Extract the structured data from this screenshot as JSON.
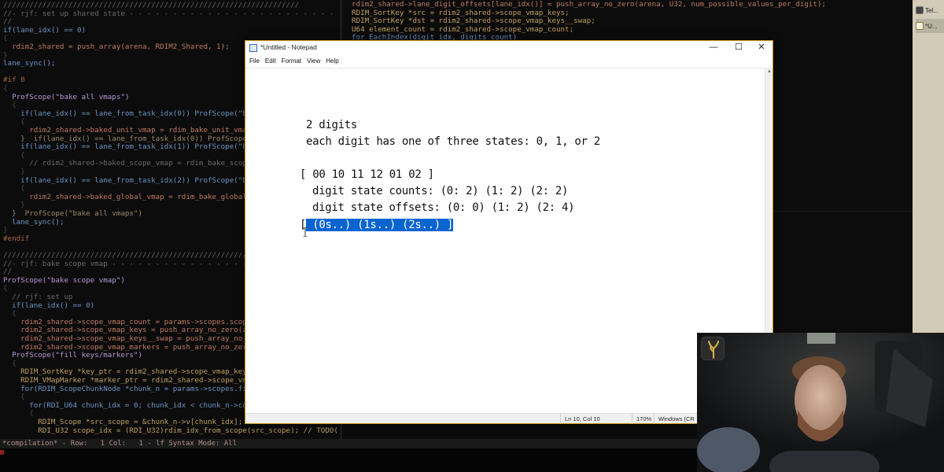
{
  "editor": {
    "left_pane_lines": [
      "////////////////////////////////////////////////////////////////////",
      "//- rjf: set up shared state - - - - - - - - - - - - - - - - - - - - - - - - - - -",
      "//",
      "if(lane_idx() == 0)",
      "{",
      "  rdim2_shared = push_array(arena, RDIM2_Shared, 1);",
      "}",
      "lane_sync();",
      "",
      "#if 0",
      "{",
      "  ProfScope(\"bake all vmaps\")",
      "  {",
      "    if(lane_idx() == lane_from_task_idx(0)) ProfScope(\"bake unit",
      "    {",
      "      rdim2_shared->baked_unit_vmap = rdim_bake_unit_vmap(arena,",
      "    }  if(lane_idx() == lane_from_task_idx(0)) ProfScope(\"bake unit vmap",
      "    if(lane_idx() == lane_from_task_idx(1)) ProfScope(\"bake sco",
      "    {",
      "      // rdim2_shared->baked_scope_vmap = rdim_bake_scope_vmap(a",
      "    }",
      "    if(lane_idx() == lane_from_task_idx(2)) ProfScope(\"bake glo",
      "    {",
      "      rdim2_shared->baked_global_vmap = rdim_bake_global_vmap(ar",
      "    }",
      "  }  ProfScope(\"bake all vmaps\")",
      "  lane_sync();",
      "}",
      "#endif",
      "",
      "////////////////////////////////////////////////////////////////////",
      "//- rjf: bake scope vmap - - - - - - - - - - - - - - - - - - - - - - - - - - - -",
      "//",
      "ProfScope(\"bake scope vmap\")",
      "{",
      "  // rjf: set up",
      "  if(lane_idx() == 0)",
      "  {",
      "    rdim2_shared->scope_vmap_count = params->scopes.scope_voff_",
      "    rdim2_shared->scope_vmap_keys = push_array_no_zero(arena, R",
      "    rdim2_shared->scope_vmap_keys__swap = push_array_no_zero(ar",
      "    rdim2_shared->scope_vmap_markers = push_array_no_zero(arena",
      "  ProfScope(\"fill keys/markers\")",
      "  {",
      "    RDIM_SortKey *key_ptr = rdim2_shared->scope_vmap_keys;",
      "    RDIM_VMapMarker *marker_ptr = rdim2_shared->scope_vmap_mar",
      "    for(RDIM_ScopeChunkNode *chunk_n = params->scopes.first; c",
      "    {",
      "      for(RDI_U64 chunk_idx = 0; chunk_idx < chunk_n->count; ch",
      "      {",
      "        RDIM_Scope *src_scope = &chunk_n->v[chunk_idx];",
      "        RDI_U32 scope_idx = (RDI_U32)rdim_idx_from_scope(src_scope); // TODO(rjf): @u64_"
    ],
    "right_pane_lines": [
      "rdim2_shared->lane_digit_offsets[lane_idx()] = push_array_no_zero(arena, U32, num_possible_values_per_digit);",
      "RDIM_SortKey *src = rdim2_shared->scope_vmap_keys;",
      "RDIM_SortKey *dst = rdim2_shared->scope_vmap_keys__swap;",
      "U64 element_count = rdim2_shared->scope_vmap_count;",
      "for EachIndex(digit_idx, digits_count)"
    ]
  },
  "status_bar": {
    "text": "*compilation* - Row:   1 Col:   1 - lf Syntax Mode: All"
  },
  "taskbar": {
    "items": [
      {
        "label": "Tel...",
        "icon": "terminal-icon"
      },
      {
        "label": "*U...",
        "icon": "notepad-icon"
      }
    ]
  },
  "notepad": {
    "title": "*Untitled - Notepad",
    "menu": [
      "File",
      "Edit",
      "Format",
      "View",
      "Help"
    ],
    "controls": {
      "minimize": "—",
      "maximize": "☐",
      "close": "✕"
    },
    "lines": [
      "2 digits",
      "each digit has one of three states: 0, 1, or 2",
      "[ 00 10 11 12 01 02 ]",
      "digit state counts: (0: 2) (1: 2) (2: 2)",
      "digit state offsets: (0: 0) (1: 2) (2: 4)"
    ],
    "last_line_prefix": "[",
    "last_line_selected": " (0s..) (1s..) (2s..) ]",
    "status": {
      "position": "Ln 10, Col 10",
      "zoom": "170%",
      "encoding": "Windows (CRLF)"
    }
  },
  "colors": {
    "selection": "#0a64d0",
    "window_border": "#c89018",
    "taskbar": "#d2cbb8"
  }
}
